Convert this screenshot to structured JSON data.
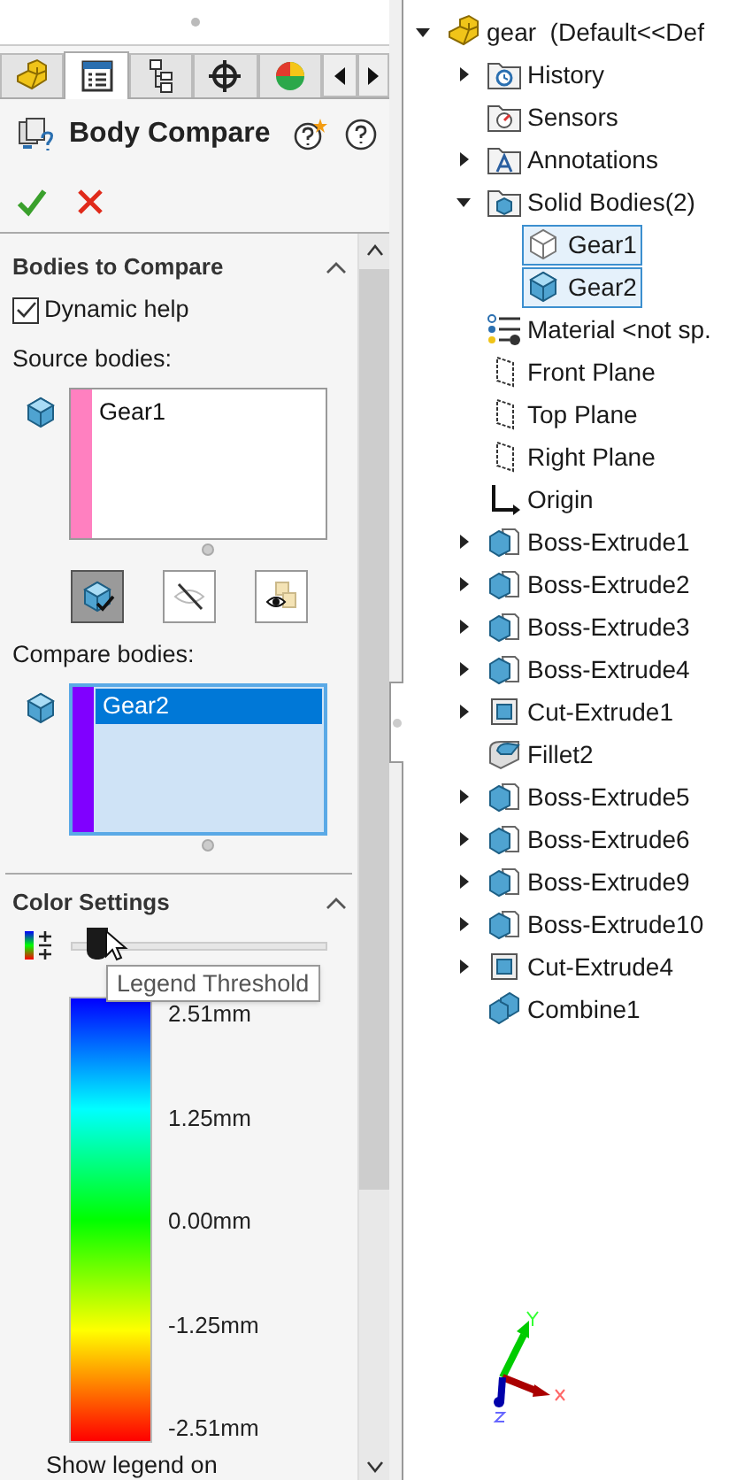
{
  "tabs": [
    {
      "kind": "part",
      "selected": false
    },
    {
      "kind": "properties",
      "selected": true
    },
    {
      "kind": "configurations",
      "selected": false
    },
    {
      "kind": "target",
      "selected": false
    },
    {
      "kind": "appearance",
      "selected": false
    }
  ],
  "panel": {
    "title": "Body Compare"
  },
  "bodies_to_compare": {
    "title": "Bodies to Compare",
    "dynamic_help": {
      "label": "Dynamic help",
      "checked": true
    },
    "source_bodies": {
      "label": "Source bodies:",
      "color": "#ff80c0",
      "items": [
        {
          "label": "Gear1",
          "selected": false
        }
      ]
    },
    "view_buttons": [
      {
        "kind": "body-check",
        "selected": true
      },
      {
        "kind": "hide",
        "selected": false
      },
      {
        "kind": "show",
        "selected": false
      }
    ],
    "compare_bodies": {
      "label": "Compare bodies:",
      "color": "#8000ff",
      "items": [
        {
          "label": "Gear2",
          "selected": true
        }
      ]
    }
  },
  "color_settings": {
    "title": "Color Settings",
    "threshold": {
      "level": 0.1,
      "tooltip": "Legend Threshold"
    },
    "legend_labels": [
      "2.51mm",
      "1.25mm",
      "0.00mm",
      "-1.25mm",
      "-2.51mm"
    ],
    "footer": "Show legend on"
  },
  "tree": [
    {
      "label": "gear  (Default<<Def",
      "kind": "part",
      "expanded": true,
      "children": [
        {
          "label": "History",
          "kind": "history",
          "expanded": false
        },
        {
          "label": "Sensors",
          "kind": "sensors"
        },
        {
          "label": "Annotations",
          "kind": "annotations",
          "expanded": false
        },
        {
          "label": "Solid Bodies(2)",
          "kind": "bodies",
          "expanded": true,
          "children": [
            {
              "label": "Gear1",
              "kind": "body-outline",
              "selected": true
            },
            {
              "label": "Gear2",
              "kind": "body-solid",
              "selected": true
            }
          ]
        },
        {
          "label": "Material <not sp.",
          "kind": "material"
        },
        {
          "label": "Front Plane",
          "kind": "plane"
        },
        {
          "label": "Top Plane",
          "kind": "plane"
        },
        {
          "label": "Right Plane",
          "kind": "plane"
        },
        {
          "label": "Origin",
          "kind": "origin"
        },
        {
          "label": "Boss-Extrude1",
          "kind": "extrude",
          "expanded": false
        },
        {
          "label": "Boss-Extrude2",
          "kind": "extrude",
          "expanded": false
        },
        {
          "label": "Boss-Extrude3",
          "kind": "extrude",
          "expanded": false
        },
        {
          "label": "Boss-Extrude4",
          "kind": "extrude",
          "expanded": false
        },
        {
          "label": "Cut-Extrude1",
          "kind": "cut",
          "expanded": false
        },
        {
          "label": "Fillet2",
          "kind": "fillet"
        },
        {
          "label": "Boss-Extrude5",
          "kind": "extrude",
          "expanded": false
        },
        {
          "label": "Boss-Extrude6",
          "kind": "extrude",
          "expanded": false
        },
        {
          "label": "Boss-Extrude9",
          "kind": "extrude",
          "expanded": false
        },
        {
          "label": "Boss-Extrude10",
          "kind": "extrude",
          "expanded": false
        },
        {
          "label": "Cut-Extrude4",
          "kind": "cut",
          "expanded": false
        },
        {
          "label": "Combine1",
          "kind": "combine"
        }
      ]
    }
  ]
}
